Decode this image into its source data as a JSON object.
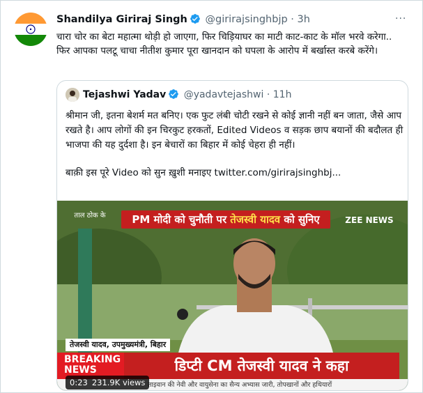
{
  "tweet": {
    "author_name": "Shandilya Giriraj Singh",
    "author_handle": "@girirajsinghbjp",
    "separator": "·",
    "time": "3h",
    "more_label": "···",
    "text": "चारा चोर का बेटा महात्मा थोड़ी हो जाएगा, फिर चिड़ियाघर का माटी काट-काट के मॉल भरवे करेगा.. फिर आपका पलटू चाचा नीतीश कुमार पूरा खानदान को घपला के आरोप में बर्खास्त करबे करेंगे।",
    "avatar_icon": "indian-flag"
  },
  "quoted_tweet": {
    "author_name": "Tejashwi Yadav",
    "author_handle": "@yadavtejashwi",
    "separator": "·",
    "time": "11h",
    "paragraph_1": "श्रीमान जी, इतना बेशर्म मत बनिए। एक फुट लंबी चोटी रखने से कोई ज्ञानी नहीं बन जाता, जैसे आप रखते है। आप लोगों की इन चिरकुट हरकतों, Edited Videos व सड़क छाप बयानों की बदौलत ही भाजपा की यह दुर्दशा है। इन बेचारों का बिहार में कोई चेहरा ही नहीं।",
    "paragraph_2": "बाक़ी इस पूरे Video को सुन ख़ुशी मनाइए  twitter.com/girirajsinghbj...",
    "video": {
      "banner_prefix": "PM मोदी को चुनौती पर ",
      "banner_highlight": "तेजस्वी यादव",
      "banner_suffix": " को सुनिए",
      "channel_logo": "ZEE NEWS",
      "show_logo": "ताल ठोक के",
      "lower_third": "तेजस्वी यादव, उपमुख्यमंत्री, बिहार",
      "breaking_line_1": "BREAKING",
      "breaking_line_2": "NEWS",
      "headline": "डिप्टी CM तेजस्वी यादव ने कहा",
      "ticker": "ताइवान की नेवी और वायुसेना का सैन्य अभ्यास जारी, तोपखानों और हथियारों",
      "duration": "0:23",
      "views": "231.9K views"
    }
  },
  "colors": {
    "verified": "#1d9bf0",
    "secondary_text": "#536471",
    "border": "#cfd9de",
    "news_red": "#c41f1f"
  }
}
